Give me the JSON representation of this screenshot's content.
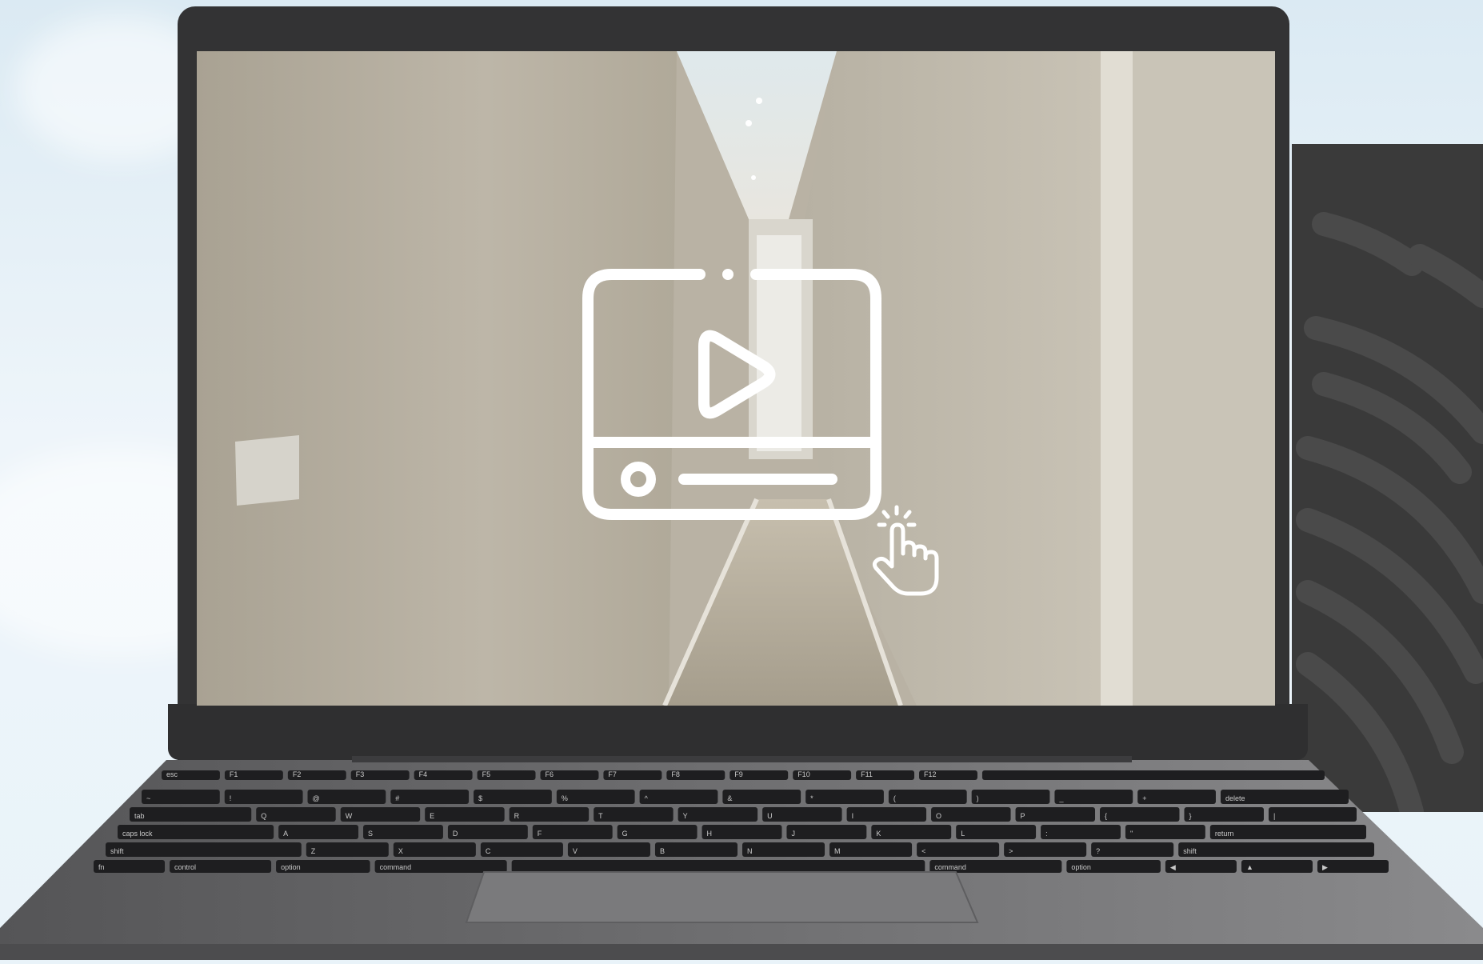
{
  "scene": {
    "description_icons": [
      "video-player-icon",
      "play-icon",
      "tap-hand-icon"
    ],
    "colors": {
      "sky": "#dbeaf3",
      "laptop_body": "#333334",
      "deck": "#6e6e70",
      "keys": "#1e1e20",
      "icon_stroke": "#ffffff",
      "wall": "#c4bcae"
    }
  },
  "keyboard": {
    "rows": [
      [
        "esc",
        "F1",
        "F2",
        "F3",
        "F4",
        "F5",
        "F6",
        "F7",
        "F8",
        "F9",
        "F10",
        "F11",
        "F12",
        ""
      ],
      [
        "~",
        "!",
        "@",
        "#",
        "$",
        "%",
        "^",
        "&",
        "*",
        "(",
        ")",
        "_",
        "+",
        "delete"
      ],
      [
        "tab",
        "Q",
        "W",
        "E",
        "R",
        "T",
        "Y",
        "U",
        "I",
        "O",
        "P",
        "{",
        "}",
        "|"
      ],
      [
        "caps lock",
        "A",
        "S",
        "D",
        "F",
        "G",
        "H",
        "J",
        "K",
        "L",
        ":",
        "\"",
        "return"
      ],
      [
        "shift",
        "Z",
        "X",
        "C",
        "V",
        "B",
        "N",
        "M",
        "<",
        ">",
        "?",
        "shift"
      ],
      [
        "fn",
        "control",
        "option",
        "command",
        "",
        "command",
        "option",
        "◀",
        "▲",
        "▶"
      ]
    ]
  }
}
